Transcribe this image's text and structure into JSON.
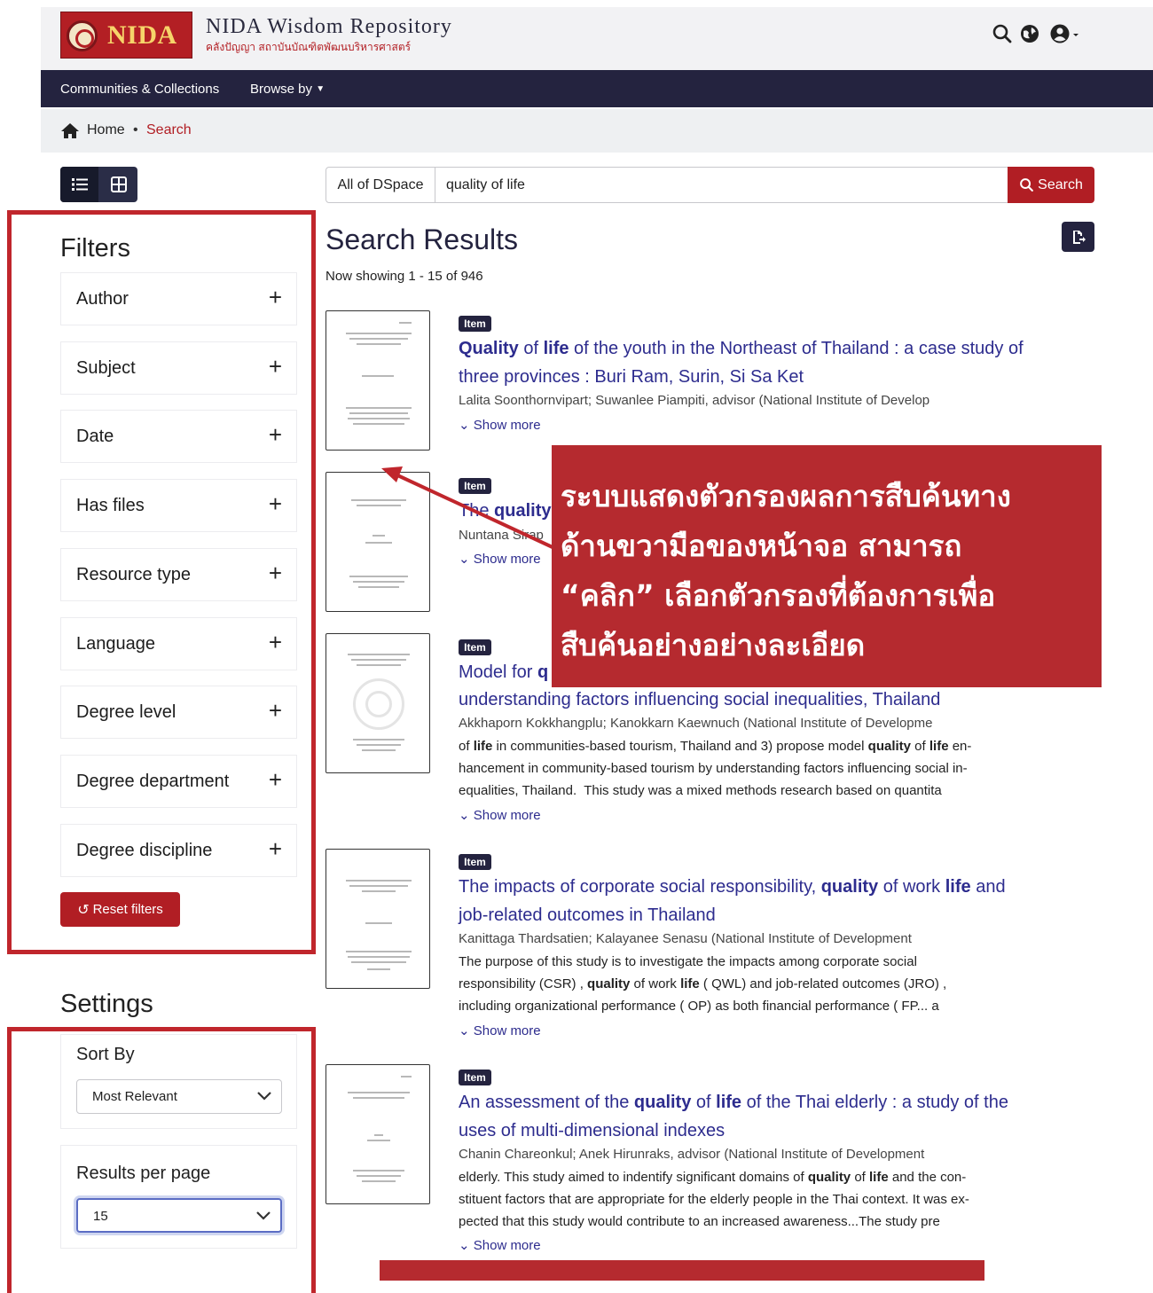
{
  "header": {
    "logo_text": "NIDA",
    "site_title": "NIDA Wisdom Repository",
    "site_subtitle": "คลังปัญญา สถาบันบัณฑิตพัฒนบริหารศาสตร์"
  },
  "nav": {
    "communities": "Communities & Collections",
    "browse_by": "Browse by"
  },
  "breadcrumb": {
    "home": "Home",
    "sep": "•",
    "current": "Search"
  },
  "search": {
    "scope": "All of DSpace",
    "query": "quality of life",
    "button": "Search"
  },
  "filters": {
    "title": "Filters",
    "facets": [
      "Author",
      "Subject",
      "Date",
      "Has files",
      "Resource type",
      "Language",
      "Degree level",
      "Degree department",
      "Degree discipline"
    ],
    "reset": "Reset filters"
  },
  "settings": {
    "title": "Settings",
    "sort_label": "Sort By",
    "sort_value": "Most Relevant",
    "rpp_label": "Results per page",
    "rpp_value": "15"
  },
  "results": {
    "title": "Search Results",
    "showing": "Now showing 1 - 15 of 946",
    "badge": "Item",
    "show_more": "Show more",
    "r1_authors": "Lalita Soonthornvipart; Suwanlee Piampiti, advisor (National Institute of Develop",
    "r2_t1": "The ",
    "r2_t2": "quality",
    "r2_authors": "Nuntana Sirap",
    "r3_t1": "Model for ",
    "r3_t2": "q",
    "r3_line2": "understanding factors influencing social inequalities, Thailand",
    "r3_authors": "Akkhaporn Kokkhangplu; Kanokkarn Kaewnuch (National Institute of Developme",
    "r4_authors": "Kanittaga Thardsatien; Kalayanee Senasu (National Institute of Development",
    "r5_authors": "Chanin Chareonkul; Anek Hirunraks, advisor (National Institute of Development"
  },
  "callout": {
    "line1": "ระบบแสดงตัวกรองผลการสืบค้นทาง",
    "line2": "ด้านขวามือของหน้าจอ สามารถ",
    "line3": "“คลิก” เลือกตัวกรองที่ต้องการเพื่อ",
    "line4": "สืบค้นอย่างอย่างละเอียด"
  },
  "colors": {
    "brand_red": "#b11e24",
    "navy": "#24233f",
    "link": "#2d2c8e"
  }
}
